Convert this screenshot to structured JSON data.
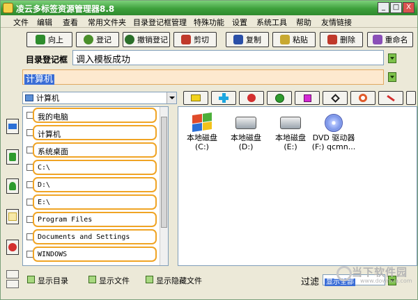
{
  "window": {
    "title": "凌云多标签资源管理器8.8",
    "min_glyph": "_",
    "max_glyph": "□",
    "close_glyph": "X"
  },
  "menu": [
    "文件",
    "编辑",
    "查看",
    "常用文件夹",
    "目录登记框管理",
    "特殊功能",
    "设置",
    "系统工具",
    "帮助",
    "友情链接"
  ],
  "toolbar": [
    {
      "label": "向上",
      "icon": "up-arrow-icon",
      "color": "#2d8c2d"
    },
    {
      "label": "登记",
      "icon": "register-icon",
      "color": "#4a8f2a"
    },
    {
      "label": "撤销登记",
      "icon": "unregister-icon",
      "color": "#2a6f2a"
    },
    {
      "label": "剪切",
      "icon": "scissors-icon",
      "color": "#c0392b"
    },
    {
      "label": "复制",
      "icon": "copy-icon",
      "color": "#2a4fa8"
    },
    {
      "label": "粘贴",
      "icon": "paste-icon",
      "color": "#c8a830"
    },
    {
      "label": "删除",
      "icon": "delete-icon",
      "color": "#c0392b"
    },
    {
      "label": "重命名",
      "icon": "rename-icon",
      "color": "#8a4fb8"
    }
  ],
  "dir_box": {
    "label": "目录登记框",
    "value": "调入模板成功"
  },
  "path": {
    "value": "计算机"
  },
  "drive_combo": {
    "value": "计算机",
    "icon": "computer-icon"
  },
  "icon_buttons": [
    {
      "name": "yellow-folder-icon",
      "color": "#f2d21b"
    },
    {
      "name": "blue-cross-icon",
      "color": "#1ea7e0"
    },
    {
      "name": "apple-icon",
      "color": "#d32f2f"
    },
    {
      "name": "green-check-icon",
      "color": "#2e9b2e"
    },
    {
      "name": "magenta-square-icon",
      "color": "#d42ad4"
    },
    {
      "name": "diamond-icon",
      "color": "#222222"
    },
    {
      "name": "target-icon",
      "color": "#e05a2a"
    },
    {
      "name": "red-line-icon",
      "color": "#d32f2f"
    }
  ],
  "left_buttons": [
    {
      "name": "arrow-right-icon",
      "color": "#2b6fd6"
    },
    {
      "name": "green-arrow-icon",
      "color": "#2e9b2e"
    },
    {
      "name": "green-question-icon",
      "color": "#2e9b2e"
    },
    {
      "name": "note-icon",
      "color": "#c8a830"
    },
    {
      "name": "red-stamp-icon",
      "color": "#d32f2f"
    }
  ],
  "folders": [
    {
      "label": "我的电脑",
      "mono": false
    },
    {
      "label": "计算机",
      "mono": false
    },
    {
      "label": "系统桌面",
      "mono": false
    },
    {
      "label": "C:\\",
      "mono": true
    },
    {
      "label": "D:\\",
      "mono": true
    },
    {
      "label": "E:\\",
      "mono": true
    },
    {
      "label": "Program Files",
      "mono": true
    },
    {
      "label": "Documents and Settings",
      "mono": true
    },
    {
      "label": "WINDOWS",
      "mono": true
    }
  ],
  "files": [
    {
      "line1": "本地磁盘 (C:)",
      "line2": "",
      "icon": "windows-drive-icon"
    },
    {
      "line1": "本地磁盘",
      "line2": "(D:)",
      "icon": "hard-drive-icon"
    },
    {
      "line1": "本地磁盘 (E:)",
      "line2": "",
      "icon": "hard-drive-icon"
    },
    {
      "line1": "DVD 驱动器",
      "line2": "(F:) qcmn...",
      "icon": "dvd-drive-icon"
    }
  ],
  "bottom": {
    "show_dir": "显示目录",
    "show_files": "显示文件",
    "show_hidden": "显示隐藏文件",
    "filter_label": "过滤",
    "filter_value": "显示全部"
  },
  "watermark": {
    "big": "当下软件园",
    "small": "www.downxia.com"
  }
}
